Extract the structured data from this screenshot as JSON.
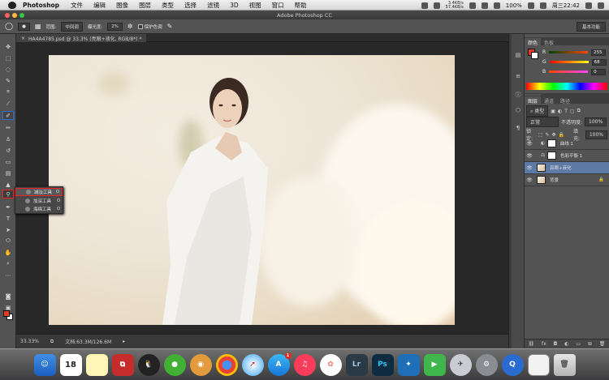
{
  "menubar": {
    "app_name": "Photoshop",
    "items": [
      "文件",
      "编辑",
      "图像",
      "图层",
      "类型",
      "选择",
      "滤镜",
      "3D",
      "视图",
      "窗口",
      "帮助"
    ],
    "net_up": "3.4KB/s",
    "net_down": "57.4KB/s",
    "battery": "100%",
    "clock": "周三22:42"
  },
  "titlebar": {
    "title": "Adobe Photoshop CC"
  },
  "options_bar": {
    "range_label": "范围:",
    "range_value": "中间调",
    "exposure_label": "曝光度:",
    "exposure_value": "2%",
    "protect_label": "保护色调",
    "workspace": "基本功能"
  },
  "document": {
    "tab_title": "HA4A4785.psd @ 33.3% (亮眼+液化, RGB/8*) *"
  },
  "status": {
    "zoom": "33.33%",
    "doc_size": "文档:63.3M/126.6M"
  },
  "tool_flyout": {
    "items": [
      {
        "label": "减淡工具",
        "key": "O"
      },
      {
        "label": "加深工具",
        "key": "O"
      },
      {
        "label": "海绵工具",
        "key": "O"
      }
    ]
  },
  "color_panel": {
    "tabs": [
      "颜色",
      "色板"
    ],
    "r_label": "R",
    "r_value": "255",
    "g_label": "G",
    "g_value": "68",
    "b_label": "B",
    "b_value": "0",
    "accent": "#e83a24"
  },
  "adjust_panel": {
    "tabs": [
      "调整",
      "样式"
    ]
  },
  "layers_panel": {
    "tabs": [
      "图层",
      "通道",
      "路径"
    ],
    "filter_label": "类型",
    "blend_mode": "正常",
    "opacity_label": "不透明度:",
    "opacity_value": "100%",
    "lock_label": "锁定:",
    "fill_label": "填充:",
    "fill_value": "100%",
    "layers": [
      {
        "name": "曲线 1",
        "active": false
      },
      {
        "name": "色彩平衡 1",
        "active": false
      },
      {
        "name": "亮眼+液化",
        "active": true
      },
      {
        "name": "背景",
        "active": false
      }
    ]
  },
  "dock": {
    "calendar_day": "18",
    "appstore_badge": "1",
    "lightroom_label": "Lr",
    "photoshop_label": "Ps"
  }
}
